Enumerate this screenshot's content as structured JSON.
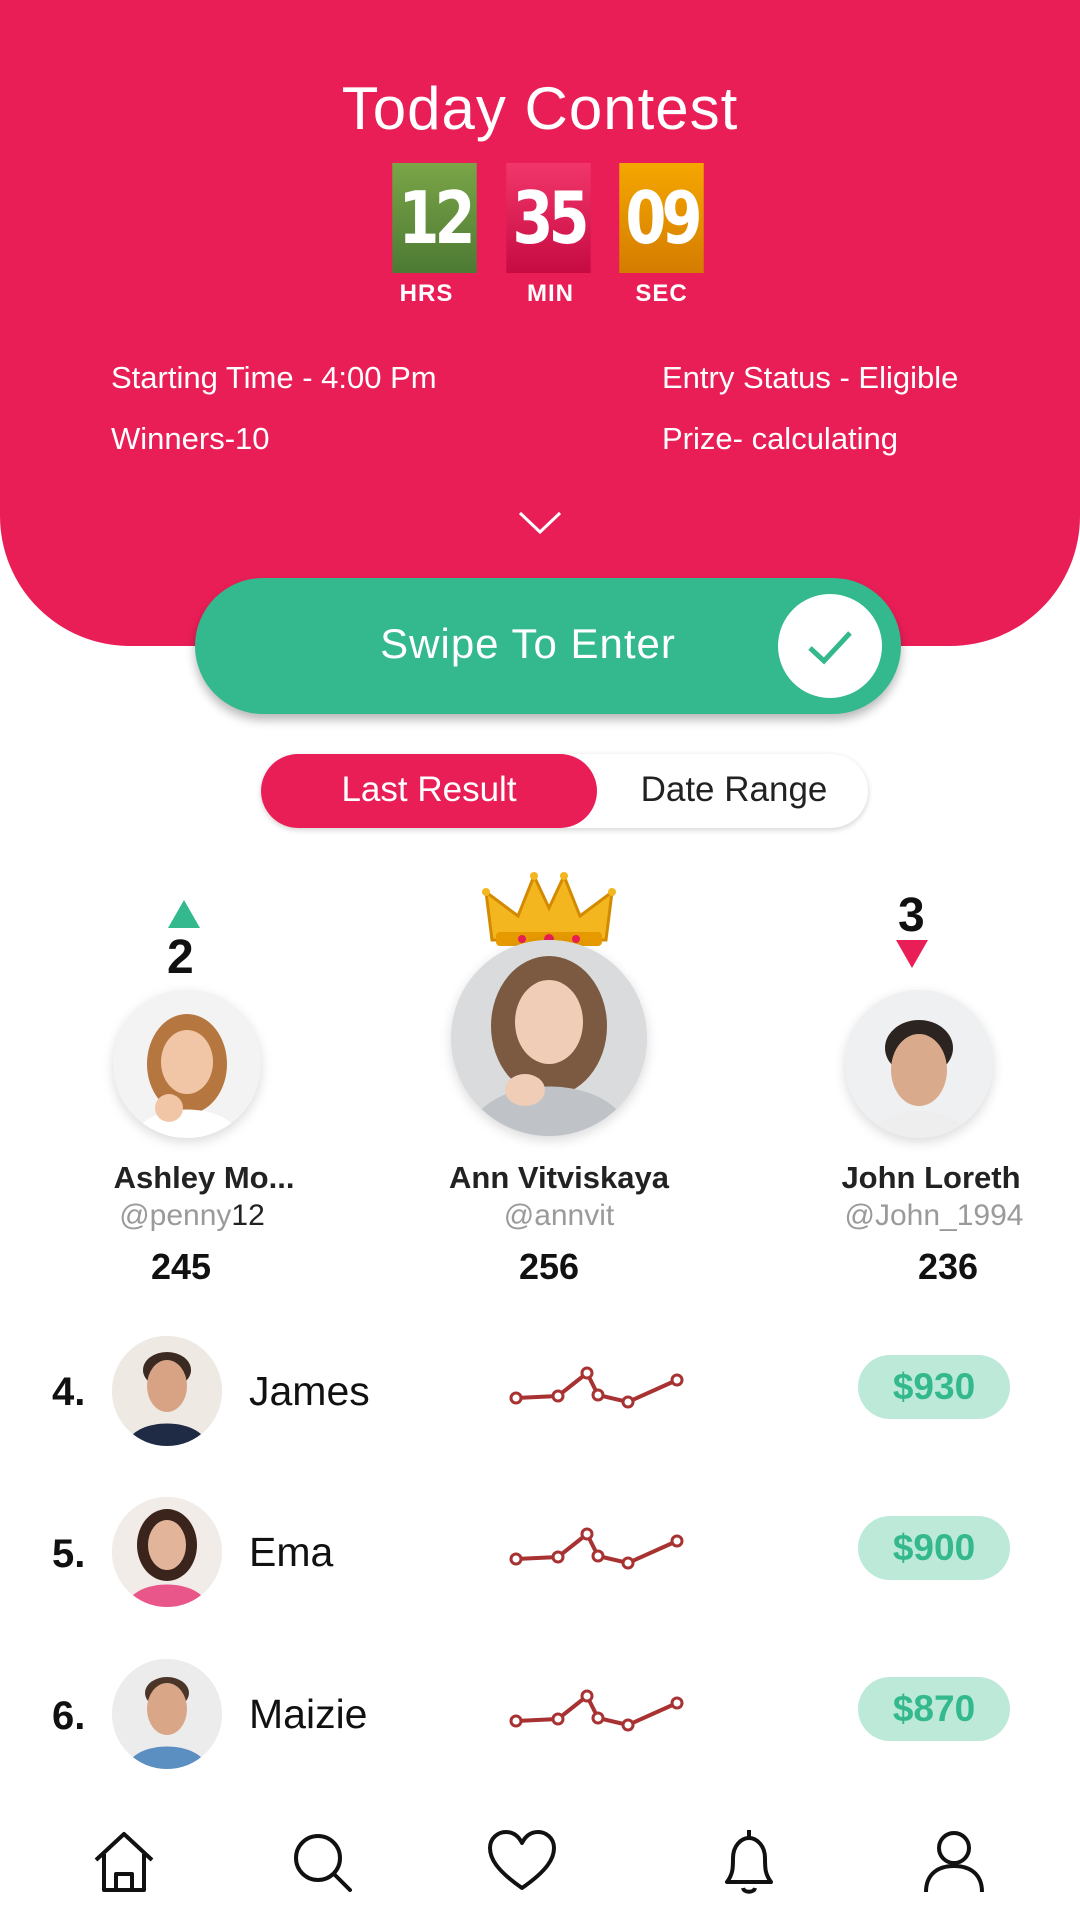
{
  "header": {
    "title": "Today Contest",
    "timer": {
      "hours": "12",
      "minutes": "35",
      "seconds": "09",
      "hours_label": "HRS",
      "minutes_label": "MIN",
      "seconds_label": "SEC"
    },
    "starting_time": "Starting Time - 4:00 Pm",
    "entry_status": "Entry Status - Eligible",
    "winners": "Winners-10",
    "prize": "Prize- calculating",
    "expand_icon": "chevron-down-icon"
  },
  "swipe": {
    "label": "Swipe To Enter",
    "icon": "check-icon"
  },
  "segment": {
    "active": "Last Result",
    "inactive": "Date Range"
  },
  "podium": {
    "second": {
      "rank": "2",
      "trend": "up",
      "name": "Ashley Mo...",
      "handle": "@penny",
      "handle_suffix": "12",
      "score": "245"
    },
    "first": {
      "name": "Ann Vitviskaya",
      "handle": "@annvit",
      "score": "256",
      "icon": "crown-icon"
    },
    "third": {
      "rank": "3",
      "trend": "down",
      "name": "John Loreth",
      "handle": "@John_1994",
      "score": "236"
    }
  },
  "leaderboard": [
    {
      "rank": "4.",
      "name": "James",
      "prize": "$930"
    },
    {
      "rank": "5.",
      "name": "Ema",
      "prize": "$900"
    },
    {
      "rank": "6.",
      "name": "Maizie",
      "prize": "$870"
    }
  ],
  "nav": [
    "home-icon",
    "search-icon",
    "heart-icon",
    "bell-icon",
    "profile-icon"
  ],
  "colors": {
    "primary": "#EA1E57",
    "accent": "#33B98D",
    "prize_bg": "#BDE9D8",
    "up": "#33B98D",
    "down": "#EA1E57"
  }
}
